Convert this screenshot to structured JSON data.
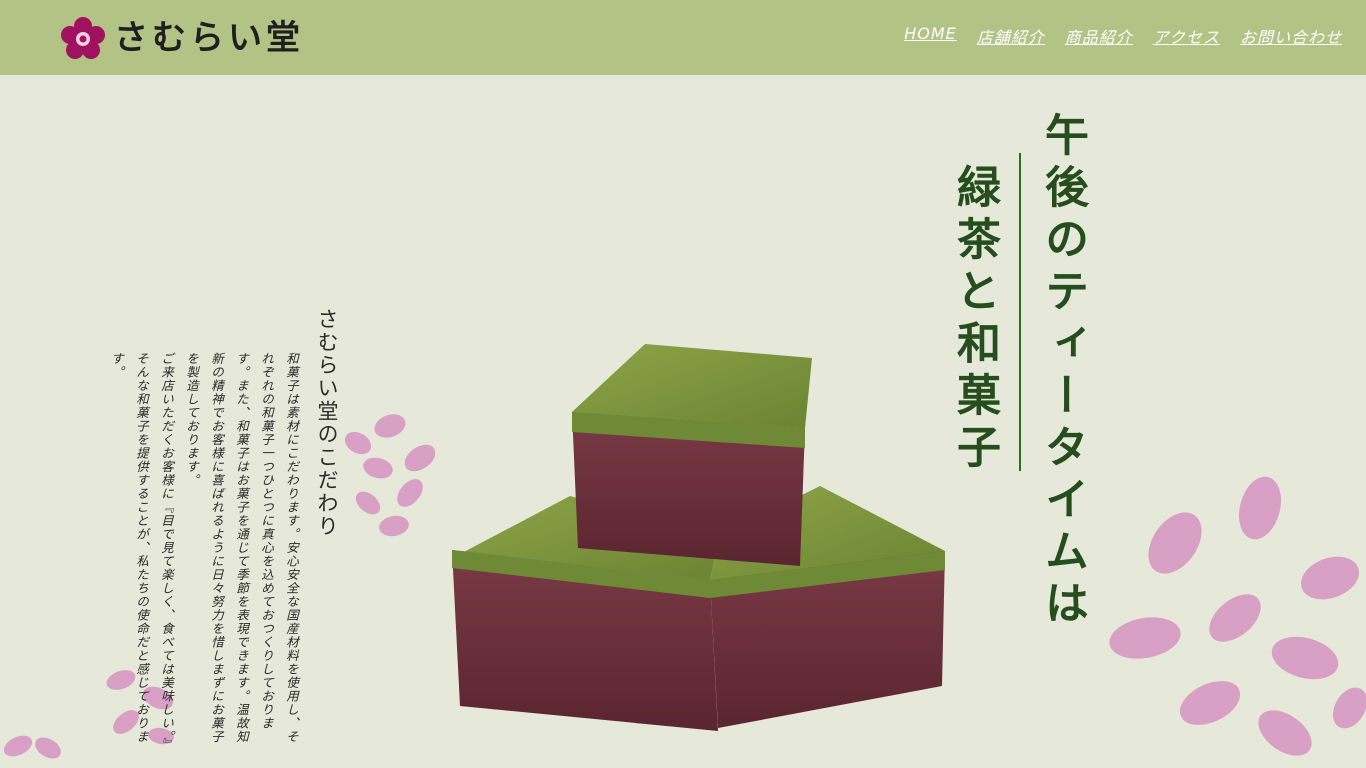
{
  "brand": {
    "name": "さむらい堂",
    "accent": "#a0125f"
  },
  "nav": {
    "items": [
      {
        "label": "HOME"
      },
      {
        "label": "店舗紹介"
      },
      {
        "label": "商品紹介"
      },
      {
        "label": "アクセス"
      },
      {
        "label": "お問い合わせ"
      }
    ]
  },
  "hero": {
    "headline_main": "午後のティータイムは",
    "headline_sub": "緑茶と和菓子"
  },
  "philosophy": {
    "title": "さむらい堂のこだわり",
    "paragraphs": [
      "和菓子は素材にこだわります。安心安全な国産材料を使用し、それぞれの和菓子一つひとつに真心を込めておつくりしております。また、和菓子はお菓子を通じて季節を表現できます。温故知新の精神でお客様に喜ばれるように日々努力を惜しまずにお菓子を製造しております。",
      "ご来店いただくお客様に『目で見て楽しく、食べては美味しい。』そんな和菓子を提供することが、私たちの使命だと感じております。"
    ]
  },
  "colors": {
    "header_bg": "#b3c386",
    "page_bg": "#e6e9da",
    "headline": "#264d1d",
    "leaf": "#d9a0c6",
    "yokan_top": "#7f9a3e",
    "yokan_body": "#6d2f3a"
  },
  "icons": [
    "plum-blossom-logo-icon",
    "leaf-decoration"
  ]
}
